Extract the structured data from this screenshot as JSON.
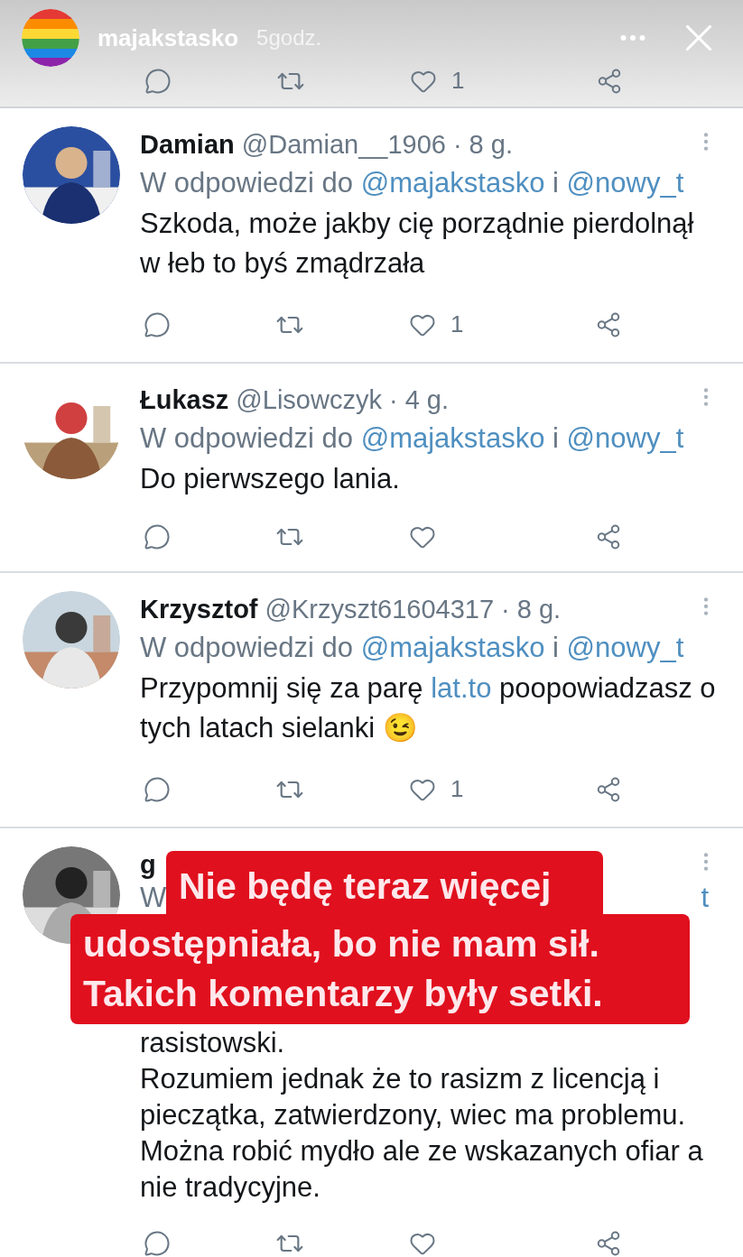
{
  "story": {
    "username": "majakstasko",
    "time": "5godz.",
    "actions": {
      "likes": "1"
    }
  },
  "tweets": [
    {
      "name": "Damian",
      "handle": "@Damian__1906",
      "time": "· 8 g.",
      "reply": [
        {
          "text": "W odpowiedzi do",
          "kind": "plain"
        },
        {
          "text": "@majakstasko",
          "kind": "mention"
        },
        {
          "text": "i",
          "kind": "plain"
        },
        {
          "text": "@nowy_t",
          "kind": "mention"
        }
      ],
      "body": [
        [
          {
            "text": "Szkoda, może jakby cię porządnie pierdolnął w łeb to byś zmądrzała",
            "kind": "plain"
          }
        ]
      ],
      "likes": "1"
    },
    {
      "name": "Łukasz",
      "handle": "@Lisowczyk",
      "time": "· 4 g.",
      "reply": [
        {
          "text": "W odpowiedzi do",
          "kind": "plain"
        },
        {
          "text": "@majakstasko",
          "kind": "mention"
        },
        {
          "text": "i",
          "kind": "plain"
        },
        {
          "text": "@nowy_t",
          "kind": "mention"
        }
      ],
      "body": [
        [
          {
            "text": "Do pierwszego lania.",
            "kind": "plain"
          }
        ]
      ]
    },
    {
      "name": "Krzysztof",
      "handle": "@Krzyszt61604317",
      "time": "· 8 g.",
      "reply": [
        {
          "text": "W odpowiedzi do",
          "kind": "plain"
        },
        {
          "text": "@majakstasko",
          "kind": "mention"
        },
        {
          "text": "i",
          "kind": "plain"
        },
        {
          "text": "@nowy_t",
          "kind": "mention"
        }
      ],
      "body": [
        [
          {
            "text": "Przypomnij się za parę",
            "kind": "plain"
          },
          {
            "text": "lat.to",
            "kind": "link"
          },
          {
            "text": "poopowiadzasz o tych latach sielanki 😉",
            "kind": "plain"
          }
        ]
      ],
      "likes": "1"
    },
    {
      "name": "g",
      "reply": [
        {
          "text": "W",
          "kind": "plain"
        },
        {
          "text": "t",
          "kind": "mention"
        }
      ],
      "body": [
        [
          {
            "text": "rasistowski.",
            "kind": "plain"
          }
        ],
        [
          {
            "text": "Rozumiem jednak że to rasizm z licencją i pieczątka, zatwierdzony, wiec ma problemu.",
            "kind": "plain"
          }
        ],
        [
          {
            "text": "Można robić mydło ale ze wskazanych ofiar a nie tradycyjne.",
            "kind": "plain"
          }
        ]
      ],
      "overlay": {
        "lines": [
          "Nie będę teraz więcej",
          "udostępniała, bo nie mam sił.",
          "Takich komentarzy były setki."
        ]
      }
    }
  ]
}
